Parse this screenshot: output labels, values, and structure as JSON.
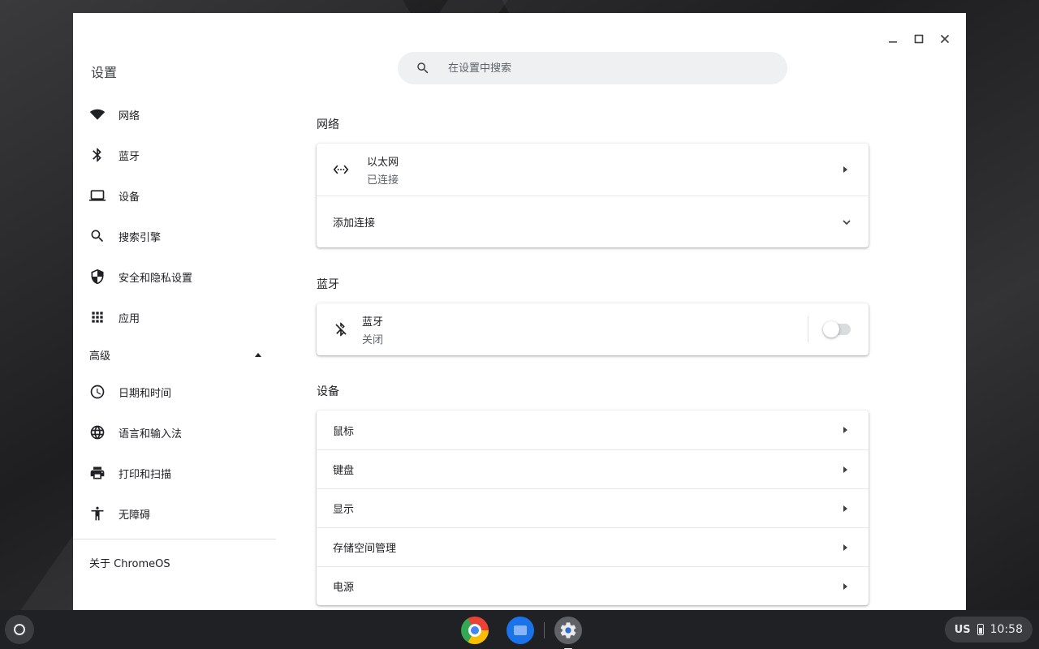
{
  "window": {
    "controls": [
      "minimize",
      "maximize",
      "close"
    ]
  },
  "app_title": "设置",
  "search": {
    "placeholder": "在设置中搜索"
  },
  "sidebar": {
    "items": [
      {
        "label": "网络",
        "icon": "wifi-icon"
      },
      {
        "label": "蓝牙",
        "icon": "bluetooth-icon"
      },
      {
        "label": "设备",
        "icon": "laptop-icon"
      },
      {
        "label": "搜索引擎",
        "icon": "search-icon"
      },
      {
        "label": "安全和隐私设置",
        "icon": "shield-icon"
      },
      {
        "label": "应用",
        "icon": "apps-grid-icon"
      }
    ],
    "advanced_label": "高级",
    "advanced_items": [
      {
        "label": "日期和时间",
        "icon": "clock-icon"
      },
      {
        "label": "语言和输入法",
        "icon": "globe-icon"
      },
      {
        "label": "打印和扫描",
        "icon": "printer-icon"
      },
      {
        "label": "无障碍",
        "icon": "accessibility-icon"
      }
    ],
    "about_label": "关于 ChromeOS"
  },
  "sections": {
    "network": {
      "title": "网络",
      "ethernet": {
        "name": "以太网",
        "status": "已连接",
        "icon": "ethernet-icon"
      },
      "add_connection": "添加连接"
    },
    "bluetooth": {
      "title": "蓝牙",
      "name": "蓝牙",
      "status": "关闭",
      "enabled": false,
      "icon": "bluetooth-disabled-icon"
    },
    "device": {
      "title": "设备",
      "rows": [
        "鼠标",
        "键盘",
        "显示",
        "存储空间管理",
        "电源"
      ]
    }
  },
  "shelf": {
    "apps": [
      "chrome-icon",
      "files-icon",
      "settings-icon"
    ],
    "tray": {
      "language": "US",
      "time": "10:58"
    }
  },
  "colors": {
    "accent": "#1a73e8",
    "shelf": "#202124",
    "search_bg": "#eef0f2"
  }
}
